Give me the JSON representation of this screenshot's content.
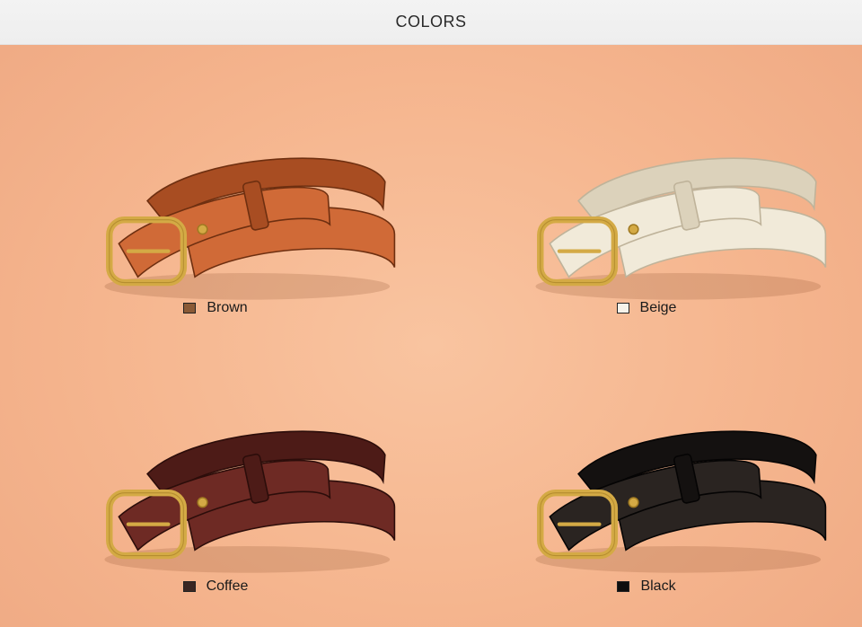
{
  "header": {
    "title": "COLORS"
  },
  "colors": [
    {
      "name": "Brown",
      "swatch": "#8a5a36",
      "leather": "#d06a37",
      "leather_dark": "#a84d22",
      "edge": "#6e2f10"
    },
    {
      "name": "Beige",
      "swatch": "#f7f3ea",
      "leather": "#f1ead9",
      "leather_dark": "#dcd2bb",
      "edge": "#bfb39a"
    },
    {
      "name": "Coffee",
      "swatch": "#3a2622",
      "leather": "#6e2a24",
      "leather_dark": "#4d1b17",
      "edge": "#2c0d0a"
    },
    {
      "name": "Black",
      "swatch": "#0e0e0e",
      "leather": "#2a2421",
      "leather_dark": "#141110",
      "edge": "#050404"
    }
  ],
  "buckle": {
    "color": "#d4aa45",
    "color_dark": "#a07a22"
  }
}
